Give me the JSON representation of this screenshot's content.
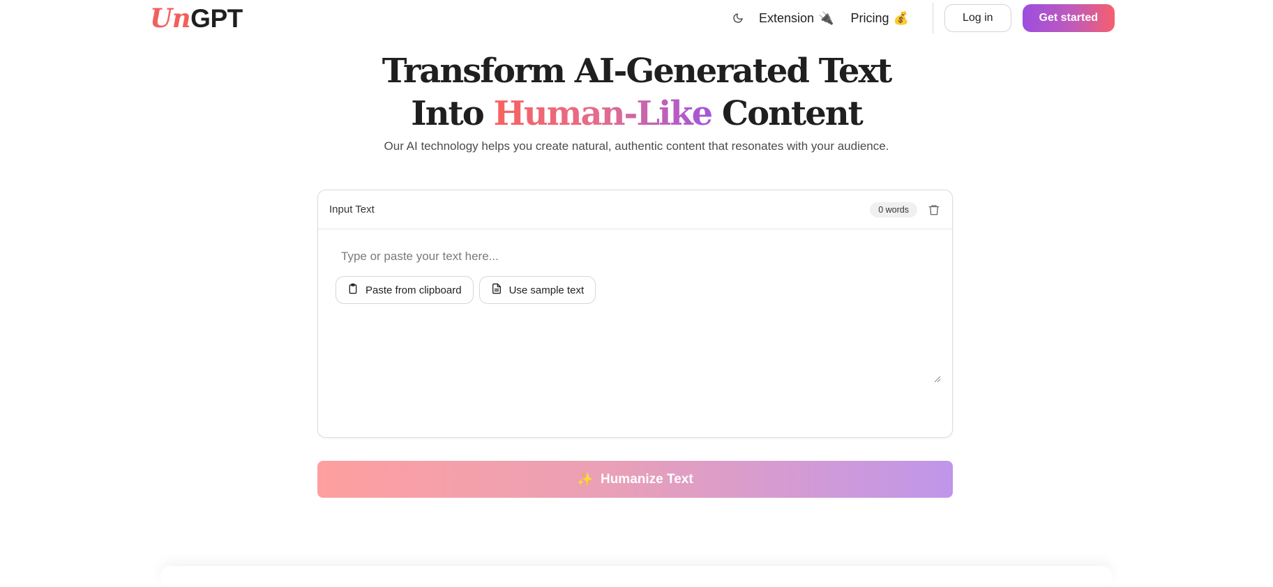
{
  "logo": {
    "part1": "Un",
    "part2": "GPT"
  },
  "nav": {
    "theme_icon": "moon-icon",
    "extension_label": "Extension",
    "extension_emoji": "🔌",
    "pricing_label": "Pricing",
    "pricing_emoji": "💰",
    "login_label": "Log in",
    "get_started_label": "Get started"
  },
  "hero": {
    "title_line1": "Transform AI-Generated Text",
    "title_line2_prefix": "Into ",
    "title_highlight": "Human-Like",
    "title_line2_suffix": " Content",
    "subtitle": "Our AI technology helps you create natural, authentic content that resonates with your audience."
  },
  "input_card": {
    "label": "Input Text",
    "word_count": "0 words",
    "placeholder": "Type or paste your text here...",
    "paste_button": "Paste from clipboard",
    "sample_button": "Use sample text"
  },
  "humanize_button": {
    "emoji": "✨",
    "label": "Humanize Text"
  },
  "colors": {
    "brand_red": "#f25f5c",
    "brand_purple": "#9d4ee0"
  }
}
